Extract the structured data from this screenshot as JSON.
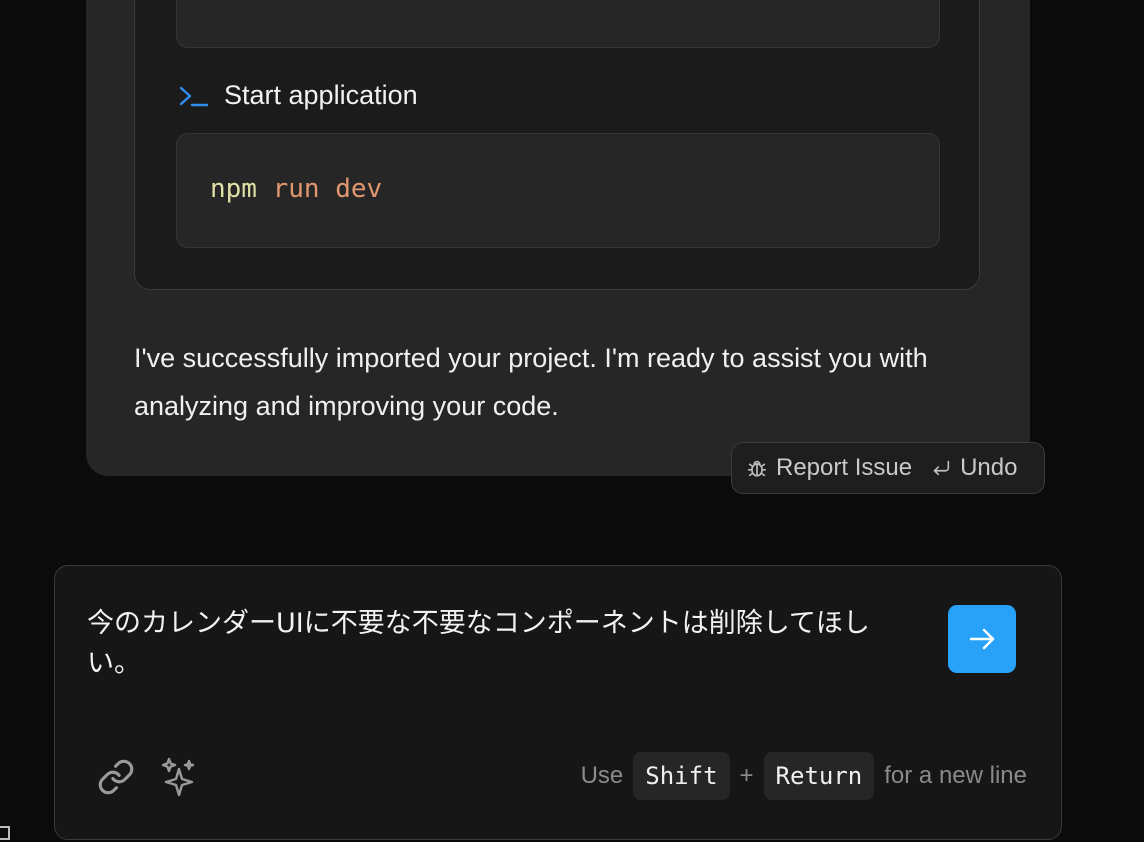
{
  "step": {
    "title": "Start application"
  },
  "code": {
    "command": "npm",
    "args": "run dev"
  },
  "message": {
    "text": "I've successfully imported your project. I'm ready to assist you with analyzing and improving your code."
  },
  "actions": {
    "report_label": "Report Issue",
    "undo_label": "Undo"
  },
  "composer": {
    "value": "今のカレンダーUIに不要な不要なコンポーネントは削除してほしい。",
    "hint_use": "Use",
    "key_shift": "Shift",
    "plus": "+",
    "key_return": "Return",
    "hint_suffix": "for a new line"
  },
  "colors": {
    "accent": "#27a2f8",
    "terminal_icon": "#2f8ff0",
    "code_cmd": "#dfe0a6",
    "code_arg": "#e0966e"
  },
  "icons": [
    "terminal-icon",
    "bug-icon",
    "undo-icon",
    "arrow-right-icon",
    "link-icon",
    "sparkle-icon"
  ]
}
